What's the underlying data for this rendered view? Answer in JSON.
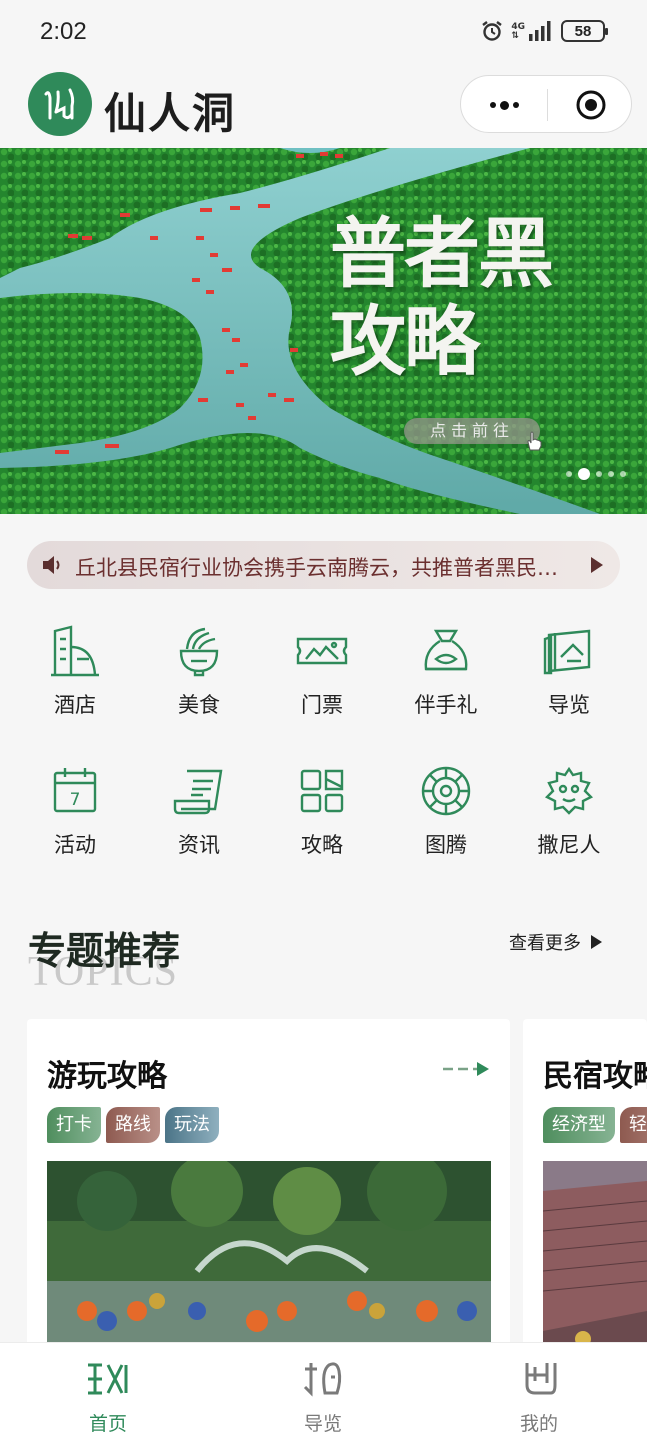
{
  "status_bar": {
    "time": "2:02",
    "network": "4G",
    "battery": "58"
  },
  "header": {
    "logo_text": "仙人洞"
  },
  "banner": {
    "title": "普者黑\n攻略",
    "cta": "点击前往",
    "slide_count": 5,
    "active_slide": 1
  },
  "notice": {
    "text": "丘北县民宿行业协会携手云南腾云，共推普者黑民宿行业发展"
  },
  "menu": [
    {
      "label": "酒店",
      "icon": "hotel-icon"
    },
    {
      "label": "美食",
      "icon": "food-icon"
    },
    {
      "label": "门票",
      "icon": "ticket-icon"
    },
    {
      "label": "伴手礼",
      "icon": "gift-icon"
    },
    {
      "label": "导览",
      "icon": "guide-map-icon"
    },
    {
      "label": "活动",
      "icon": "calendar-icon"
    },
    {
      "label": "资讯",
      "icon": "news-icon"
    },
    {
      "label": "攻略",
      "icon": "strategy-icon"
    },
    {
      "label": "图腾",
      "icon": "totem-icon"
    },
    {
      "label": "撒尼人",
      "icon": "sani-people-icon"
    }
  ],
  "calendar_day": "7",
  "topics": {
    "title": "专题推荐",
    "subtitle": "TOPICS",
    "more_label": "查看更多",
    "cards": [
      {
        "title": "游玩攻略",
        "tags": [
          "打卡",
          "路线",
          "玩法"
        ]
      },
      {
        "title": "民宿攻略",
        "tags": [
          "经济型",
          "轻奢型"
        ]
      }
    ]
  },
  "tabbar": [
    {
      "label": "首页",
      "active": true
    },
    {
      "label": "导览",
      "active": false
    },
    {
      "label": "我的",
      "active": false
    }
  ],
  "colors": {
    "brand_green": "#2f8a5a",
    "tab_active": "#2f8a5a",
    "tab_inactive": "#7a7a7a",
    "notice_text": "#6b2f2f"
  }
}
